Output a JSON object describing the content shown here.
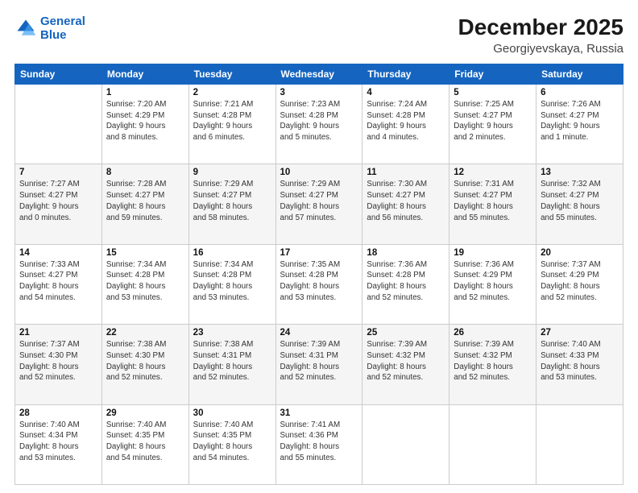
{
  "logo": {
    "line1": "General",
    "line2": "Blue"
  },
  "title": "December 2025",
  "subtitle": "Georgiyevskaya, Russia",
  "days_header": [
    "Sunday",
    "Monday",
    "Tuesday",
    "Wednesday",
    "Thursday",
    "Friday",
    "Saturday"
  ],
  "weeks": [
    [
      {
        "day": "",
        "info": ""
      },
      {
        "day": "1",
        "info": "Sunrise: 7:20 AM\nSunset: 4:29 PM\nDaylight: 9 hours\nand 8 minutes."
      },
      {
        "day": "2",
        "info": "Sunrise: 7:21 AM\nSunset: 4:28 PM\nDaylight: 9 hours\nand 6 minutes."
      },
      {
        "day": "3",
        "info": "Sunrise: 7:23 AM\nSunset: 4:28 PM\nDaylight: 9 hours\nand 5 minutes."
      },
      {
        "day": "4",
        "info": "Sunrise: 7:24 AM\nSunset: 4:28 PM\nDaylight: 9 hours\nand 4 minutes."
      },
      {
        "day": "5",
        "info": "Sunrise: 7:25 AM\nSunset: 4:27 PM\nDaylight: 9 hours\nand 2 minutes."
      },
      {
        "day": "6",
        "info": "Sunrise: 7:26 AM\nSunset: 4:27 PM\nDaylight: 9 hours\nand 1 minute."
      }
    ],
    [
      {
        "day": "7",
        "info": "Sunrise: 7:27 AM\nSunset: 4:27 PM\nDaylight: 9 hours\nand 0 minutes."
      },
      {
        "day": "8",
        "info": "Sunrise: 7:28 AM\nSunset: 4:27 PM\nDaylight: 8 hours\nand 59 minutes."
      },
      {
        "day": "9",
        "info": "Sunrise: 7:29 AM\nSunset: 4:27 PM\nDaylight: 8 hours\nand 58 minutes."
      },
      {
        "day": "10",
        "info": "Sunrise: 7:29 AM\nSunset: 4:27 PM\nDaylight: 8 hours\nand 57 minutes."
      },
      {
        "day": "11",
        "info": "Sunrise: 7:30 AM\nSunset: 4:27 PM\nDaylight: 8 hours\nand 56 minutes."
      },
      {
        "day": "12",
        "info": "Sunrise: 7:31 AM\nSunset: 4:27 PM\nDaylight: 8 hours\nand 55 minutes."
      },
      {
        "day": "13",
        "info": "Sunrise: 7:32 AM\nSunset: 4:27 PM\nDaylight: 8 hours\nand 55 minutes."
      }
    ],
    [
      {
        "day": "14",
        "info": "Sunrise: 7:33 AM\nSunset: 4:27 PM\nDaylight: 8 hours\nand 54 minutes."
      },
      {
        "day": "15",
        "info": "Sunrise: 7:34 AM\nSunset: 4:28 PM\nDaylight: 8 hours\nand 53 minutes."
      },
      {
        "day": "16",
        "info": "Sunrise: 7:34 AM\nSunset: 4:28 PM\nDaylight: 8 hours\nand 53 minutes."
      },
      {
        "day": "17",
        "info": "Sunrise: 7:35 AM\nSunset: 4:28 PM\nDaylight: 8 hours\nand 53 minutes."
      },
      {
        "day": "18",
        "info": "Sunrise: 7:36 AM\nSunset: 4:28 PM\nDaylight: 8 hours\nand 52 minutes."
      },
      {
        "day": "19",
        "info": "Sunrise: 7:36 AM\nSunset: 4:29 PM\nDaylight: 8 hours\nand 52 minutes."
      },
      {
        "day": "20",
        "info": "Sunrise: 7:37 AM\nSunset: 4:29 PM\nDaylight: 8 hours\nand 52 minutes."
      }
    ],
    [
      {
        "day": "21",
        "info": "Sunrise: 7:37 AM\nSunset: 4:30 PM\nDaylight: 8 hours\nand 52 minutes."
      },
      {
        "day": "22",
        "info": "Sunrise: 7:38 AM\nSunset: 4:30 PM\nDaylight: 8 hours\nand 52 minutes."
      },
      {
        "day": "23",
        "info": "Sunrise: 7:38 AM\nSunset: 4:31 PM\nDaylight: 8 hours\nand 52 minutes."
      },
      {
        "day": "24",
        "info": "Sunrise: 7:39 AM\nSunset: 4:31 PM\nDaylight: 8 hours\nand 52 minutes."
      },
      {
        "day": "25",
        "info": "Sunrise: 7:39 AM\nSunset: 4:32 PM\nDaylight: 8 hours\nand 52 minutes."
      },
      {
        "day": "26",
        "info": "Sunrise: 7:39 AM\nSunset: 4:32 PM\nDaylight: 8 hours\nand 52 minutes."
      },
      {
        "day": "27",
        "info": "Sunrise: 7:40 AM\nSunset: 4:33 PM\nDaylight: 8 hours\nand 53 minutes."
      }
    ],
    [
      {
        "day": "28",
        "info": "Sunrise: 7:40 AM\nSunset: 4:34 PM\nDaylight: 8 hours\nand 53 minutes."
      },
      {
        "day": "29",
        "info": "Sunrise: 7:40 AM\nSunset: 4:35 PM\nDaylight: 8 hours\nand 54 minutes."
      },
      {
        "day": "30",
        "info": "Sunrise: 7:40 AM\nSunset: 4:35 PM\nDaylight: 8 hours\nand 54 minutes."
      },
      {
        "day": "31",
        "info": "Sunrise: 7:41 AM\nSunset: 4:36 PM\nDaylight: 8 hours\nand 55 minutes."
      },
      {
        "day": "",
        "info": ""
      },
      {
        "day": "",
        "info": ""
      },
      {
        "day": "",
        "info": ""
      }
    ]
  ]
}
